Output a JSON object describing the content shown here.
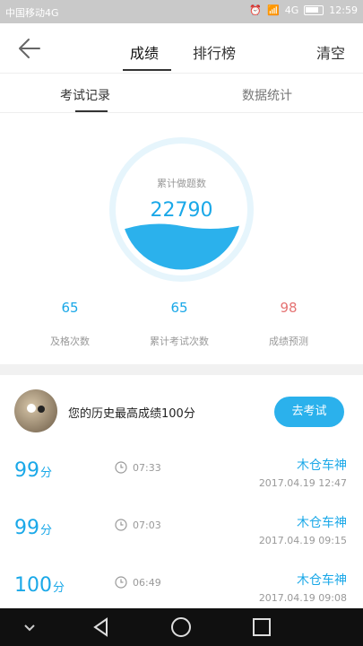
{
  "status_bar": {
    "carrier": "中国移动4G",
    "network": "4G",
    "time": "12:59"
  },
  "header": {
    "tab_score": "成绩",
    "tab_ranking": "排行榜",
    "clear": "清空"
  },
  "subtabs": {
    "exam_records": "考试记录",
    "data_stats": "数据统计"
  },
  "summary": {
    "total_questions_label": "累计做题数",
    "total_questions_value": "22790",
    "stats": [
      {
        "value": "65",
        "label": "及格次数"
      },
      {
        "value": "65",
        "label": "累计考试次数"
      },
      {
        "value": "98",
        "label": "成绩预测"
      }
    ]
  },
  "best": {
    "text": "您的历史最高成绩100分",
    "button": "去考试"
  },
  "records": [
    {
      "score": "99",
      "unit": "分",
      "duration": "07:33",
      "name": "木仓车神",
      "date": "2017.04.19  12:47"
    },
    {
      "score": "99",
      "unit": "分",
      "duration": "07:03",
      "name": "木仓车神",
      "date": "2017.04.19  09:15"
    },
    {
      "score": "100",
      "unit": "分",
      "duration": "06:49",
      "name": "木仓车神",
      "date": "2017.04.19  09:08"
    }
  ],
  "colors": {
    "accent": "#1aa8e8",
    "button": "#2bb1ec",
    "prediction": "#e57373"
  },
  "icons": [
    "back-arrow-icon",
    "clock-icon",
    "nav-back-icon",
    "nav-home-icon",
    "nav-recent-icon",
    "nav-collapse-icon"
  ]
}
